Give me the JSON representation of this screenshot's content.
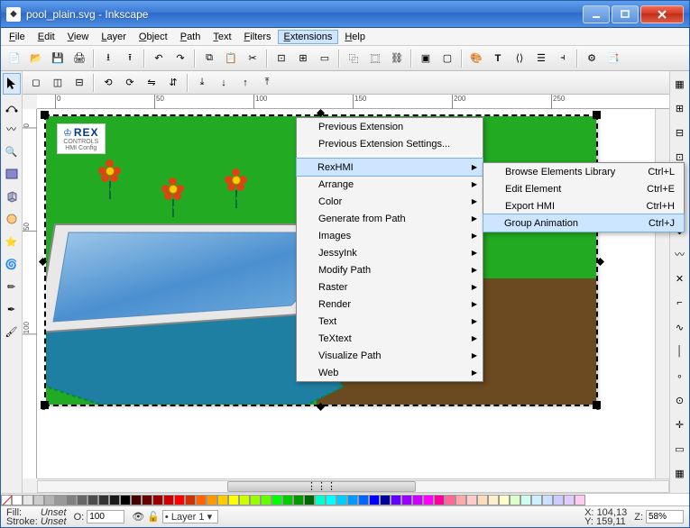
{
  "title": "pool_plain.svg - Inkscape",
  "menubar": [
    "File",
    "Edit",
    "View",
    "Layer",
    "Object",
    "Path",
    "Text",
    "Filters",
    "Extensions",
    "Help"
  ],
  "ext_menu": {
    "top": [
      "Previous Extension",
      "Previous Extension Settings..."
    ],
    "items": [
      "RexHMI",
      "Arrange",
      "Color",
      "Generate from Path",
      "Images",
      "JessyInk",
      "Modify Path",
      "Raster",
      "Render",
      "Text",
      "TeXtext",
      "Visualize Path",
      "Web"
    ],
    "highlight": 0
  },
  "sub_menu": {
    "items": [
      {
        "label": "Browse Elements Library",
        "key": "Ctrl+L"
      },
      {
        "label": "Edit Element",
        "key": "Ctrl+E"
      },
      {
        "label": "Export HMI",
        "key": "Ctrl+H"
      },
      {
        "label": "Group Animation",
        "key": "Ctrl+J"
      }
    ],
    "highlight": 3
  },
  "ruler_h": [
    "0",
    "50",
    "100",
    "150",
    "200",
    "250"
  ],
  "ruler_v": [
    "0",
    "50",
    "100"
  ],
  "rex": {
    "brand": "REX",
    "tag": "CONTROLS",
    "sub": "HMI Config"
  },
  "status": {
    "fill_label": "Fill:",
    "fill_value": "Unset",
    "stroke_label": "Stroke:",
    "stroke_value": "Unset",
    "opacity_label": "O:",
    "opacity": "100",
    "layer": "Layer 1",
    "x_label": "X:",
    "x": "104,13",
    "y_label": "Y:",
    "y": "159,11",
    "z_label": "Z:",
    "z": "58%"
  },
  "palette": [
    "#ffffff",
    "#e6e6e6",
    "#cccccc",
    "#b3b3b3",
    "#999999",
    "#808080",
    "#666666",
    "#4d4d4d",
    "#333333",
    "#1a1a1a",
    "#000000",
    "#440000",
    "#660000",
    "#990000",
    "#cc0000",
    "#ff0000",
    "#cc3300",
    "#ff6600",
    "#ff9900",
    "#ffcc00",
    "#ffff00",
    "#ccff00",
    "#99ff00",
    "#66ff00",
    "#00ff00",
    "#00cc00",
    "#009900",
    "#006600",
    "#00ffcc",
    "#00ffff",
    "#00ccff",
    "#0099ff",
    "#0066ff",
    "#0000ff",
    "#000099",
    "#6600ff",
    "#9900ff",
    "#cc00ff",
    "#ff00ff",
    "#ff0099",
    "#ff6699",
    "#ffaaaa",
    "#ffcccc",
    "#ffddbb",
    "#ffeecc",
    "#ffffcc",
    "#ddffcc",
    "#ccffee",
    "#ccf0ff",
    "#cce0ff",
    "#ccccff",
    "#e0ccff",
    "#ffccf0"
  ]
}
